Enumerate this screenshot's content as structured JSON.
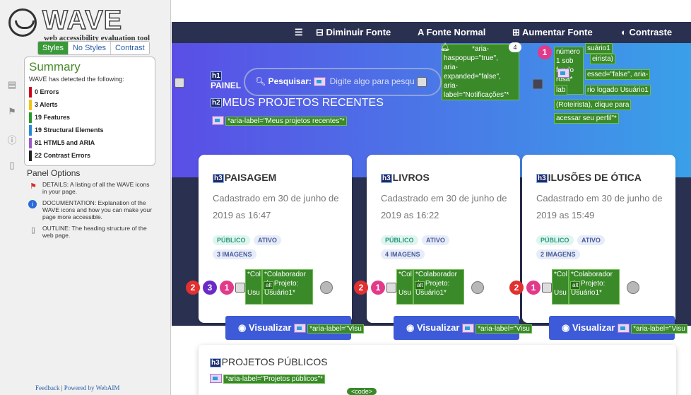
{
  "wave": {
    "logo_text": "WAVE",
    "subtitle": "web accessibility evaluation tool",
    "tabs": [
      "Styles",
      "No Styles",
      "Contrast"
    ],
    "summary_title": "Summary",
    "intro": "WAVE has detected the following:",
    "counts": [
      {
        "label": "0 Errors",
        "color": "#d0021b"
      },
      {
        "label": "3 Alerts",
        "color": "#f0c419"
      },
      {
        "label": "19 Features",
        "color": "#2a9a2a"
      },
      {
        "label": "19 Structural Elements",
        "color": "#2a8ad8"
      },
      {
        "label": "81 HTML5 and ARIA",
        "color": "#9a5ac8"
      },
      {
        "label": "22 Contrast Errors",
        "color": "#222222"
      }
    ],
    "panel_title": "Panel Options",
    "panel_items": [
      {
        "icon": "flag-icon",
        "text": "DETAILS: A listing of all the WAVE icons in your page."
      },
      {
        "icon": "info-icon",
        "text": "DOCUMENTATION: Explanation of the WAVE icons and how you can make your page more accessible."
      },
      {
        "icon": "document-icon",
        "text": "OUTLINE: The heading structure of the web page."
      }
    ],
    "feedback": "Feedback",
    "powered": "Powered by WebAIM"
  },
  "site": {
    "nav": [
      "Diminuir Fonte",
      "Fonte Normal",
      "Aumentar Fonte",
      "Contraste"
    ],
    "painel": "PAINEL",
    "h2_title": "MEUS PROJETOS RECENTES",
    "h2_aria": "*aria-label=\"Meus projetos recentes\"*",
    "search_label": "Pesquisar:",
    "search_placeholder": "Digite algo para pesqu",
    "notif_badge": "4",
    "aria_notif": [
      "*aria-",
      "haspopup=\"true\",",
      "aria-",
      "expanded=\"false\",",
      "aria-",
      "label=\"Notificações\"*"
    ],
    "user_tooltip": [
      "número",
      "1 sob",
      "fundo",
      "rosa*"
    ],
    "user_tooltip_prefix": [
      "lab"
    ],
    "user_text": [
      "suário1",
      "eirista)",
      "essed=\"false\", aria-",
      "rio logado Usuário1",
      "(Roteirista), clique para",
      "acessar seu perfil\"*"
    ],
    "cards": [
      {
        "title": "PAISAGEM",
        "date": "Cadastrado em 30 de junho de 2019 as 16:47",
        "tags": [
          "PÚBLICO",
          "ATIVO"
        ],
        "images": "3 IMAGENS",
        "nums": [
          "2",
          "3",
          "1"
        ]
      },
      {
        "title": "LIVROS",
        "date": "Cadastrado em 30 de junho de 2019 as 16:22",
        "tags": [
          "PÚBLICO",
          "ATIVO"
        ],
        "images": "4 IMAGENS",
        "nums": [
          "2",
          "1"
        ]
      },
      {
        "title": "ILUSÕES DE ÓTICA",
        "date": "Cadastrado em 30 de junho de 2019 as 15:49",
        "tags": [
          "PÚBLICO",
          "ATIVO"
        ],
        "images": "2 IMAGENS",
        "nums": [
          "2",
          "1"
        ]
      }
    ],
    "colab": [
      "*Colaborador",
      "do Projeto:",
      "Usuário1*"
    ],
    "colab_short": [
      "*Col",
      "Usu"
    ],
    "alt": "alt",
    "view_button": "Visualizar",
    "view_aria": "*aria-label=\"Visu",
    "public_title": "PROJETOS PÚBLICOS",
    "public_aria": "*aria-label=\"Projetos públicos\"*",
    "code_tag": "<code>",
    "h1": "h1",
    "h2": "h2",
    "h3": "h3"
  }
}
